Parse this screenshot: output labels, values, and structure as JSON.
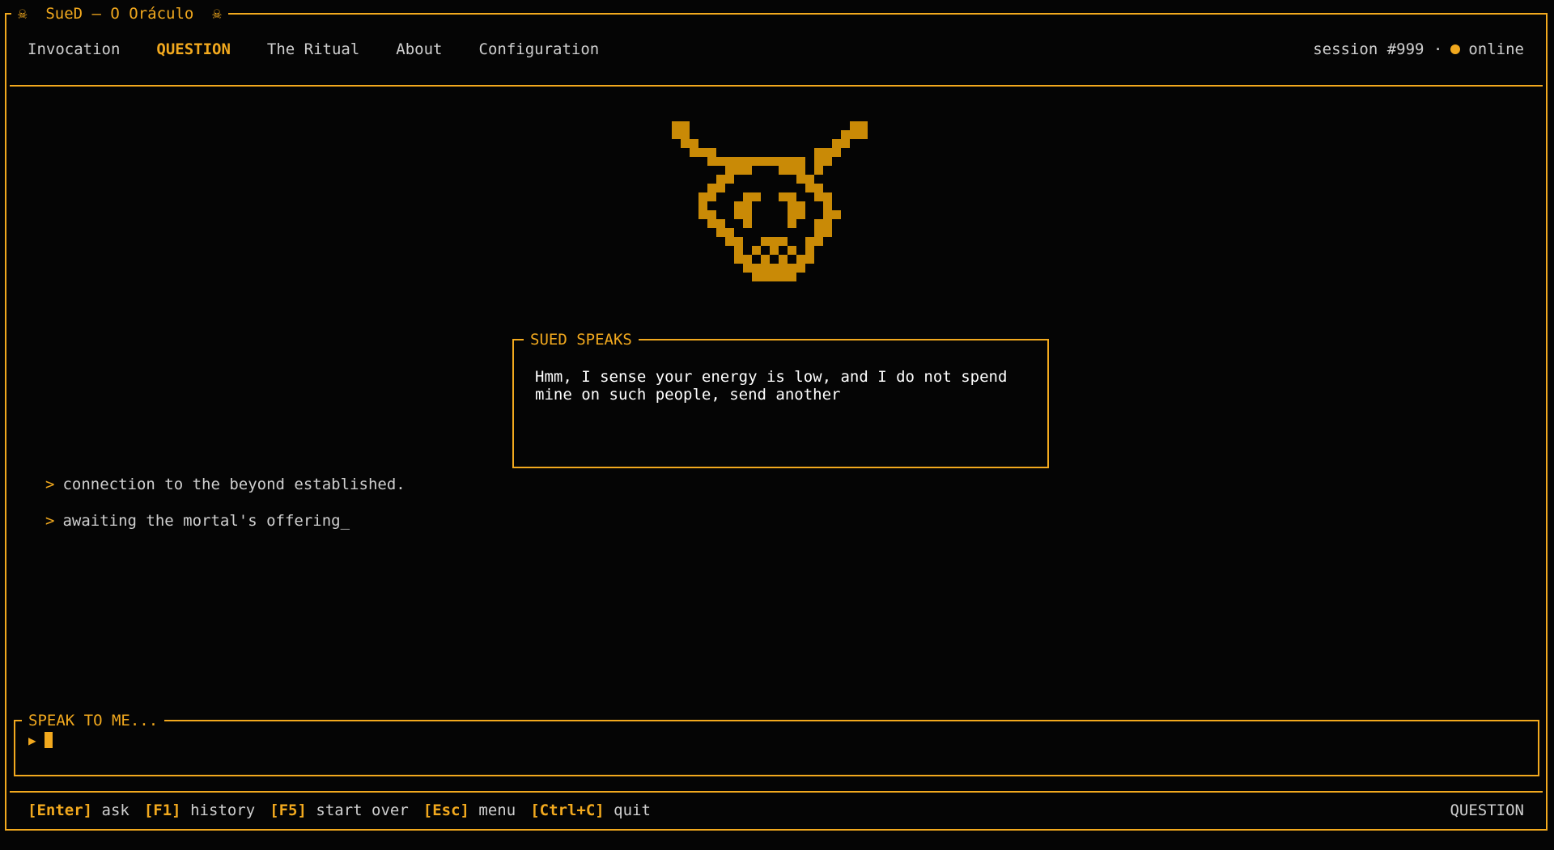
{
  "window": {
    "title": "SueD — O Oráculo",
    "title_icon": "skull-icon"
  },
  "nav": {
    "items": [
      {
        "label": "Invocation",
        "active": false
      },
      {
        "label": "QUESTION",
        "active": true
      },
      {
        "label": "The Ritual",
        "active": false
      },
      {
        "label": "About",
        "active": false
      },
      {
        "label": "Configuration",
        "active": false
      }
    ]
  },
  "status": {
    "session": "session #999 ·",
    "state": "online",
    "dot_color": "#f2a91e"
  },
  "speech": {
    "title": "SUED SPEAKS",
    "text": "Hmm, I sense your energy is low, and I do not spend mine on such people, send another"
  },
  "log": {
    "prompt": ">",
    "lines": [
      "connection to the beyond established.",
      "awaiting the mortal's offering_"
    ]
  },
  "input": {
    "label": "SPEAK TO ME...",
    "arrow": "▶",
    "value": "",
    "placeholder": ""
  },
  "footer": {
    "hints": [
      {
        "key": "[Enter]",
        "desc": "ask"
      },
      {
        "key": "[F1]",
        "desc": "history"
      },
      {
        "key": "[F5]",
        "desc": "start over"
      },
      {
        "key": "[Esc]",
        "desc": "menu"
      },
      {
        "key": "[Ctrl+C]",
        "desc": "quit"
      }
    ],
    "mode": "QUESTION"
  },
  "colors": {
    "accent": "#f2a91e",
    "art": "#c98a06",
    "background": "#050505",
    "text": "#cfcfcf"
  }
}
